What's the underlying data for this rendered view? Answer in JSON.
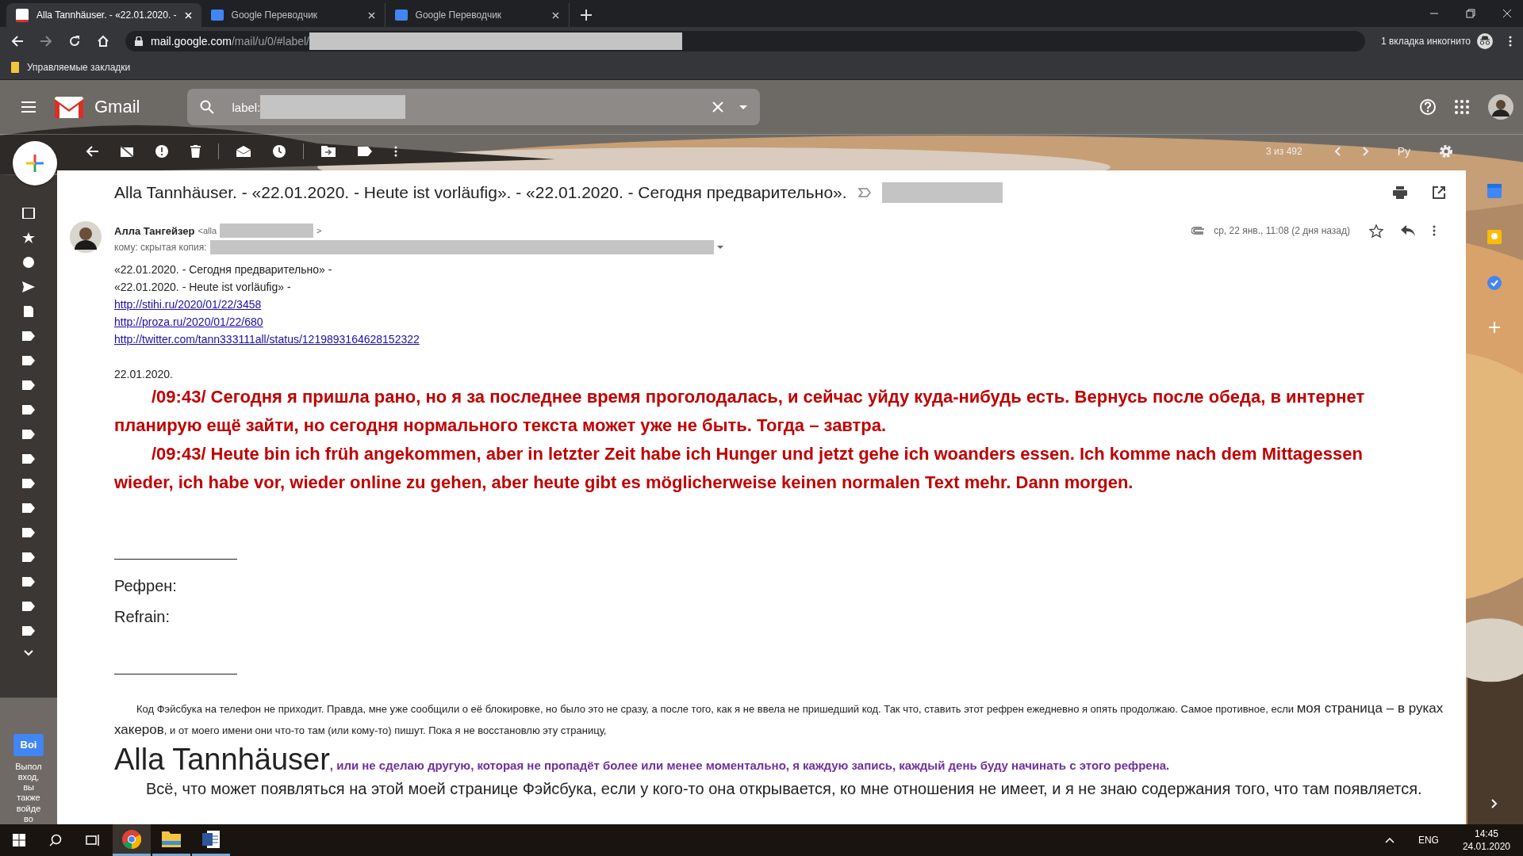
{
  "browser": {
    "tabs": [
      {
        "title": "Alla Tannhäuser. - «22.01.2020. -",
        "selected": true
      },
      {
        "title": "Google Переводчик",
        "selected": false
      },
      {
        "title": "Google Переводчик",
        "selected": false
      }
    ],
    "address": {
      "host": "mail.google.com",
      "path": "/mail/u/0/#label/"
    },
    "incognito": "1 вкладка инкогнито",
    "bookmarks": [
      "Управляемые закладки"
    ]
  },
  "gmail": {
    "product": "Gmail",
    "search": {
      "value": "label:"
    },
    "pager": "3 из 492",
    "input_tool": "Ру"
  },
  "email": {
    "subject": "Alla Tannhäuser. - «22.01.2020. - Heute ist vorläufig». - «22.01.2020. - Сегодня предварительно».",
    "sender": {
      "name": "Алла Тангейзер",
      "address_start": "<alla",
      "address_end": ">"
    },
    "to_label": "кому: скрытая копия:",
    "date": "ср, 22 янв., 11:08 (2 дня назад)",
    "body": [
      {
        "kind": "plain",
        "text": "«22.01.2020. - Сегодня предварительно» -"
      },
      {
        "kind": "plain",
        "text": "«22.01.2020. - Heute ist vorläufig» -"
      },
      {
        "kind": "link",
        "text": "http://stihi.ru/2020/01/22/3458"
      },
      {
        "kind": "link",
        "text": "http://proza.ru/2020/01/22/680"
      },
      {
        "kind": "link",
        "text": "http://twitter.com/tann333111all/status/1219893164628152322"
      },
      {
        "kind": "date",
        "text": "22.01.2020."
      },
      {
        "kind": "alert",
        "text": "/09:43/ Сегодня я пришла рано, но я за последнее время проголодалась, и сейчас уйду куда-нибудь есть. Вернусь после обеда, в интернет планирую ещё зайти, но сегодня нормального текста может уже не быть. Тогда – завтра."
      },
      {
        "kind": "alert",
        "text": "/09:43/ Heute bin ich früh angekommen, aber in letzter Zeit habe ich Hunger und jetzt gehe ich woanders essen. Ich komme nach dem Mittagessen wieder, ich habe vor, wieder online zu gehen, aber heute gibt es möglicherweise keinen normalen Text mehr. Dann morgen."
      },
      {
        "kind": "rule"
      },
      {
        "kind": "refrain",
        "text": "Рефрен:"
      },
      {
        "kind": "refrain",
        "text": "Refrain:"
      },
      {
        "kind": "rule"
      },
      {
        "kind": "note",
        "parts": [
          "Код Фэйсбука на телефон не приходит. Правда, мне уже сообщили о её блокировке, но было это не сразу, а после того, как я не ввела не пришедший код. Так что, ставить этот рефрен ежедневно я опять продолжаю. Самое противное, если ",
          "моя страница – в руках хакеров",
          ", и от моего имени они что-то там (или кому-то) пишут. Пока я не восстановлю эту страницу,"
        ]
      },
      {
        "kind": "signature",
        "parts": [
          "Alla Tannhäuser",
          ", или не сделаю другую, которая не пропадёт более или менее моментально, я каждую запись, каждый день буду начинать с этого рефрена."
        ]
      },
      {
        "kind": "large",
        "text": "Всё, что может появляться на этой моей странице Фэйсбука, если у кого-то она открывается, ко мне отношения не имеет, и я не знаю содержания того, что там появляется."
      }
    ]
  },
  "sidebar_promo": {
    "button": "Boi",
    "text": "Выпол вход, вы также войде во"
  },
  "taskbar": {
    "language": "ENG",
    "time": "14:45",
    "date": "24.01.2020"
  }
}
